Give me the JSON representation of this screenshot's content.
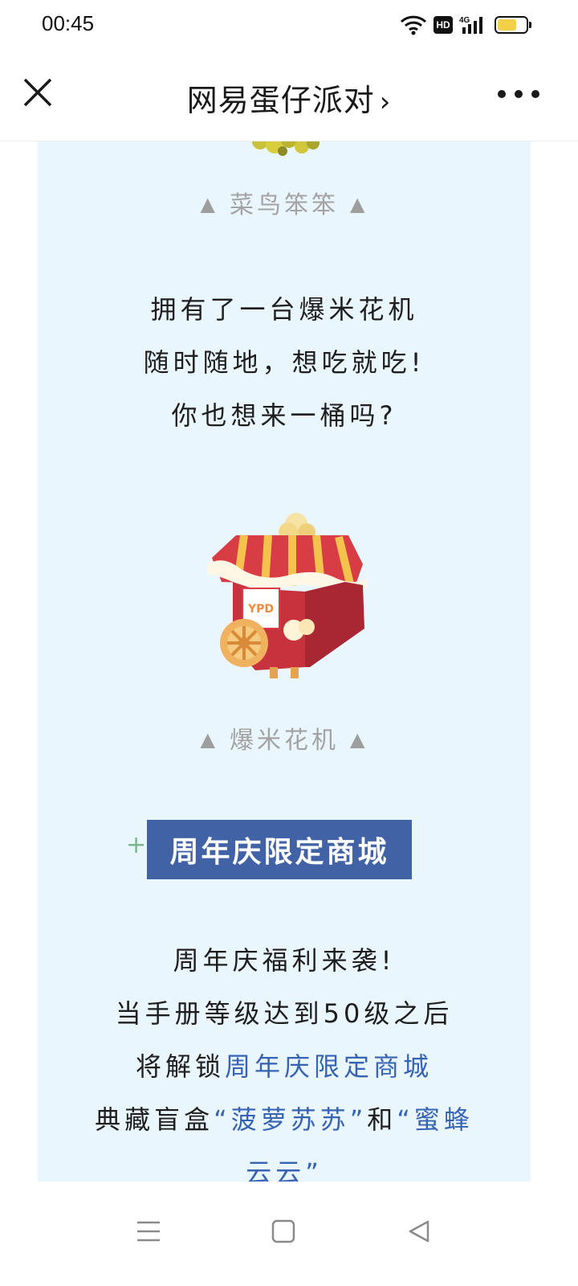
{
  "status_bar": {
    "time": "00:45",
    "hd_label": "HD",
    "network_label": "4G",
    "battery_level": 0.7,
    "icons": [
      "wifi-icon",
      "signal-icon",
      "battery-icon"
    ]
  },
  "nav": {
    "title": "网易蛋仔派对",
    "title_chevron": "›",
    "close_icon": "close-icon",
    "more_icon": "more-icon"
  },
  "article": {
    "caption_1": "菜鸟笨笨",
    "para_1": [
      "拥有了一台爆米花机",
      "随时随地，想吃就吃!",
      "你也想来一桶吗?"
    ],
    "popcorn_sign": "YPD",
    "caption_2": "爆米花机",
    "caption_marker": "▲",
    "section_plus": "+",
    "section_title": "周年庆限定商城",
    "para_2": {
      "line_1": "周年庆福利来袭!",
      "line_2": "当手册等级达到50级之后",
      "line_3_prefix": "将解锁",
      "line_3_highlight": "周年庆限定商城",
      "line_4_prefix": "典藏盲盒",
      "line_4_highlight_1": "“菠萝苏苏”",
      "line_4_mid": "和",
      "line_4_highlight_2": "“蜜蜂",
      "line_5_highlight": "云云”"
    }
  },
  "bottom_nav": {
    "icons": [
      "menu-icon",
      "home-icon",
      "back-icon"
    ]
  },
  "colors": {
    "background": "#e9f6fd",
    "caption": "#a3a3a3",
    "highlight": "#3663b3",
    "section_box": "#4163a6",
    "plus": "#7fb58e"
  }
}
